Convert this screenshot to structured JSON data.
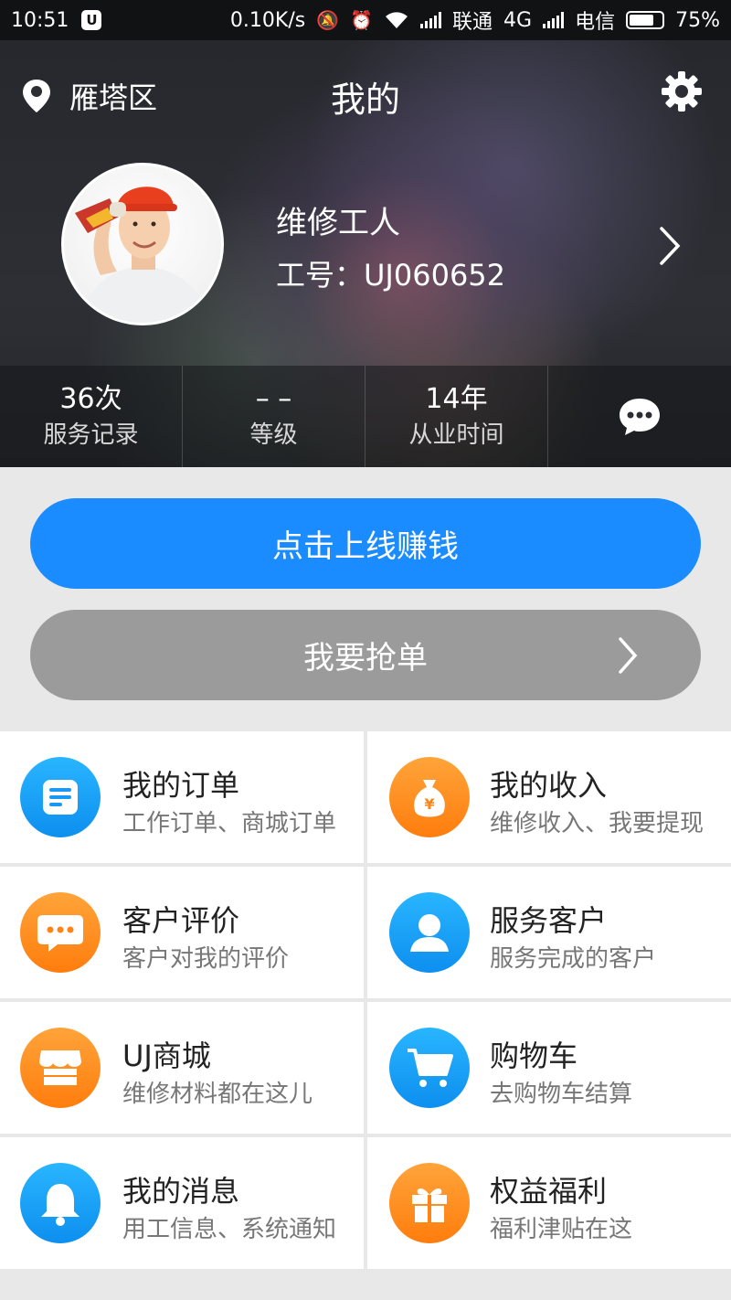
{
  "status_bar": {
    "time": "10:51",
    "net_speed": "0.10K/s",
    "carrier1": "联通",
    "net_type": "4G",
    "carrier2": "电信",
    "battery": "75%"
  },
  "header": {
    "location": "雁塔区",
    "title": "我的",
    "worker_name": "维修工人",
    "worker_id": "工号：UJ060652"
  },
  "stats": [
    {
      "value": "36次",
      "label": "服务记录"
    },
    {
      "value": "– –",
      "label": "等级"
    },
    {
      "value": "14年",
      "label": "从业时间"
    }
  ],
  "buttons": {
    "online": "点击上线赚钱",
    "grab": "我要抢单"
  },
  "menu": [
    {
      "title": "我的订单",
      "subtitle": "工作订单、商城订单",
      "icon": "order-list-icon",
      "color": "#1ea6f7"
    },
    {
      "title": "我的收入",
      "subtitle": "维修收入、我要提现",
      "icon": "money-bag-icon",
      "color": "#ff8c1f"
    },
    {
      "title": "客户评价",
      "subtitle": "客户对我的评价",
      "icon": "comment-bubble-icon",
      "color": "#ff8c1f"
    },
    {
      "title": "服务客户",
      "subtitle": "服务完成的客户",
      "icon": "person-icon",
      "color": "#1ea6f7"
    },
    {
      "title": "UJ商城",
      "subtitle": "维修材料都在这儿",
      "icon": "store-icon",
      "color": "#ff8c1f"
    },
    {
      "title": "购物车",
      "subtitle": "去购物车结算",
      "icon": "cart-icon",
      "color": "#1ea6f7"
    },
    {
      "title": "我的消息",
      "subtitle": "用工信息、系统通知",
      "icon": "bell-icon",
      "color": "#1ea6f7"
    },
    {
      "title": "权益福利",
      "subtitle": "福利津贴在这",
      "icon": "gift-icon",
      "color": "#ff8c1f"
    }
  ]
}
